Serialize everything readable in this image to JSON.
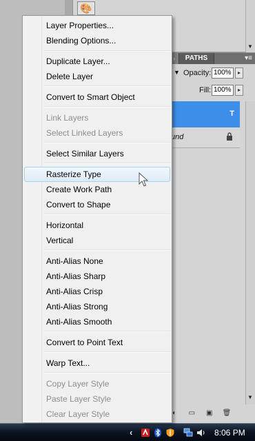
{
  "layers_panel": {
    "paths_tab": "PATHS",
    "opacity_label": "Opacity:",
    "opacity_value": "100%",
    "fill_label": "Fill:",
    "fill_value": "100%",
    "background_layer_label": "und"
  },
  "context_menu": {
    "items": [
      {
        "label": "Layer Properties...",
        "enabled": true
      },
      {
        "label": "Blending Options...",
        "enabled": true
      },
      {
        "label": "Duplicate Layer...",
        "enabled": true
      },
      {
        "label": "Delete Layer",
        "enabled": true
      },
      {
        "label": "Convert to Smart Object",
        "enabled": true
      },
      {
        "label": "Link Layers",
        "enabled": false
      },
      {
        "label": "Select Linked Layers",
        "enabled": false
      },
      {
        "label": "Select Similar Layers",
        "enabled": true
      },
      {
        "label": "Rasterize Type",
        "enabled": true,
        "hovered": true
      },
      {
        "label": "Create Work Path",
        "enabled": true
      },
      {
        "label": "Convert to Shape",
        "enabled": true
      },
      {
        "label": "Horizontal",
        "enabled": true
      },
      {
        "label": "Vertical",
        "enabled": true
      },
      {
        "label": "Anti-Alias None",
        "enabled": true
      },
      {
        "label": "Anti-Alias Sharp",
        "enabled": true
      },
      {
        "label": "Anti-Alias Crisp",
        "enabled": true
      },
      {
        "label": "Anti-Alias Strong",
        "enabled": true
      },
      {
        "label": "Anti-Alias Smooth",
        "enabled": true
      },
      {
        "label": "Convert to Point Text",
        "enabled": true
      },
      {
        "label": "Warp Text...",
        "enabled": true
      },
      {
        "label": "Copy Layer Style",
        "enabled": false
      },
      {
        "label": "Paste Layer Style",
        "enabled": false
      },
      {
        "label": "Clear Layer Style",
        "enabled": false
      }
    ]
  },
  "taskbar": {
    "clock": "8:06 PM"
  },
  "colors": {
    "selected_layer": "#3d8ee8",
    "menu_hover_border": "#a8d0ef",
    "taskbar": "#0d1522"
  }
}
